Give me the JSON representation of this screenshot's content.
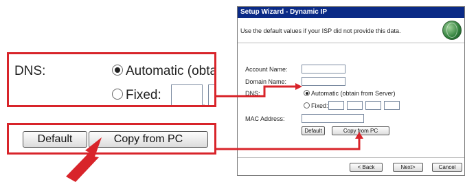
{
  "zoom": {
    "dns_label": "DNS:",
    "automatic_text": "Automatic (obtai",
    "fixed_text": "Fixed:",
    "fixed_dot": ".",
    "default_button": "Default",
    "copy_button": "Copy from PC"
  },
  "dialog": {
    "title": "Setup Wizard - Dynamic IP",
    "instruction": "Use the default values if your ISP did not provide this data.",
    "fields": {
      "account_name": "Account Name:",
      "domain_name": "Domain Name:",
      "dns": "DNS:",
      "mac_address": "MAC Address:"
    },
    "dns_options": {
      "automatic": "Automatic (obtain from Server)",
      "fixed": "Fixed:"
    },
    "buttons": {
      "default": "Default",
      "copy_from_pc": "Copy from PC",
      "back": "< Back",
      "next": "Next>",
      "cancel": "Cancel"
    }
  },
  "colors": {
    "callout_red": "#d8242a",
    "titlebar_blue": "#0a2a86"
  }
}
